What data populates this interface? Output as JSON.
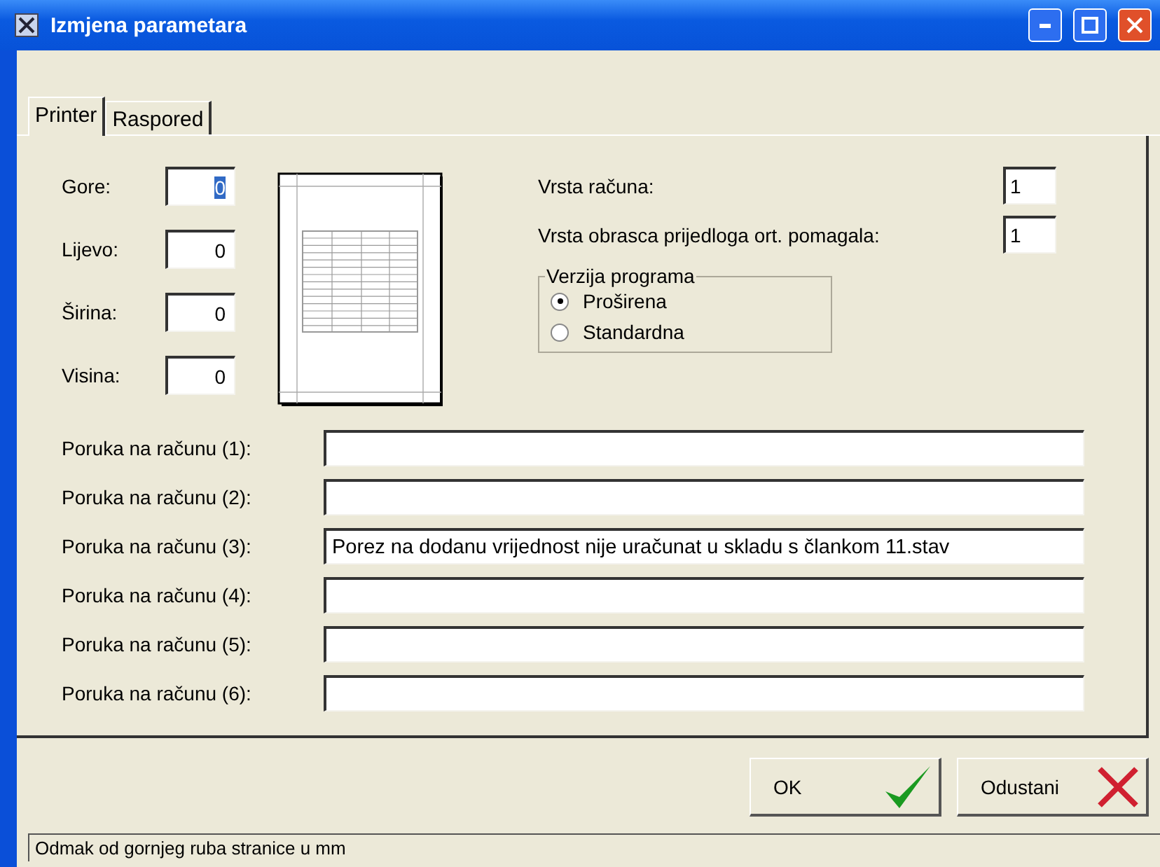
{
  "window": {
    "title": "Izmjena parametara"
  },
  "tabs": [
    {
      "label": "Printer",
      "selected": true
    },
    {
      "label": "Raspored",
      "selected": false
    }
  ],
  "margins": [
    {
      "label": "Gore:",
      "value": "0",
      "focused": true
    },
    {
      "label": "Lijevo:",
      "value": "0",
      "focused": false
    },
    {
      "label": "Širina:",
      "value": "0",
      "focused": false
    },
    {
      "label": "Visina:",
      "value": "0",
      "focused": false
    }
  ],
  "settings": [
    {
      "label": "Vrsta računa:",
      "value": "1"
    },
    {
      "label": "Vrsta obrasca prijedloga ort. pomagala:",
      "value": "1"
    }
  ],
  "version_group": {
    "title": "Verzija programa",
    "options": [
      {
        "label": "Proširena",
        "selected": true
      },
      {
        "label": "Standardna",
        "selected": false
      }
    ]
  },
  "messages": [
    {
      "label": "Poruka na računu (1):"
    },
    {
      "label": "Poruka na računu (2):"
    },
    {
      "label": "Poruka na računu (3):",
      "value": "Porez na dodanu vrijednost nije uračunat u skladu s člankom 11.stav"
    },
    {
      "label": "Poruka na računu (4):"
    },
    {
      "label": "Poruka na računu (5):"
    },
    {
      "label": "Poruka na računu (6):"
    }
  ],
  "buttons": [
    {
      "label": "OK",
      "kind": "ok"
    },
    {
      "label": "Odustani",
      "kind": "cancel"
    }
  ],
  "status_bar": "Odmak od gornjeg ruba stranice u mm"
}
